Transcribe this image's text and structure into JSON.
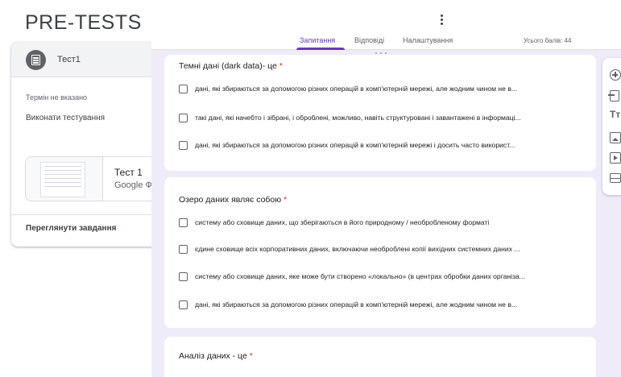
{
  "page": {
    "title": "PRE-TESTS"
  },
  "assignment": {
    "title": "Тест1",
    "due": "Термін не вказано",
    "action": "Виконати тестування",
    "attachment": {
      "title": "Тест 1",
      "type": "Google Форми"
    },
    "view_link": "Переглянути завдання"
  },
  "form_editor": {
    "tabs": [
      {
        "label": "Запитання",
        "active": true
      },
      {
        "label": "Відповіді",
        "active": false
      },
      {
        "label": "Налаштування",
        "active": false
      }
    ],
    "total_score": "Усього балів: 44",
    "questions": [
      {
        "title": "Темні дані (dark data)- це",
        "required_mark": "*",
        "options": [
          "дані, які збираються за допомогою різних операцій в комп'ютерній мережі, але жодним чином не в...",
          "такі дані, які начебто і зібрані, і оброблені, можливо, навіть структуровані і завантажені в інформаці...",
          "дані, які збираються за допомогою різних операцій в комп'ютерній мережі і досить часто використ..."
        ]
      },
      {
        "title": "Озеро даних являє собою",
        "required_mark": "*",
        "options": [
          "систему або сховище даних, що зберігаються в його природному / необробленому форматі",
          "єдине сховище всіх корпоративних даних, включаючи необроблені копії вихідних системних даних ...",
          "систему або сховище даних, яке може бути створено «локально» (в центрах обробки даних організа...",
          "дані, які збираються за допомогою різних операцій в комп'ютерній мережі, але жодним чином не в..."
        ]
      },
      {
        "title": "Аналіз даних - це",
        "required_mark": "*",
        "options": []
      }
    ],
    "toolbar": {
      "title_glyph": "Tт",
      "icons": [
        "add-question-icon",
        "import-questions-icon",
        "add-title-icon",
        "add-image-icon",
        "add-video-icon",
        "add-section-icon"
      ]
    }
  },
  "colors": {
    "accent": "#673ab7",
    "editor_bg": "#f0ebf8",
    "required": "#d93025"
  }
}
